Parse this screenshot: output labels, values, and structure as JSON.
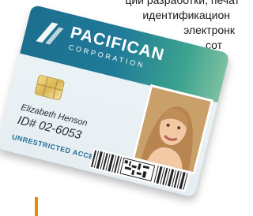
{
  "background": {
    "text_lines": [
      "ции разработки, печат",
      "идентификацион",
      "электронк",
      "сот"
    ],
    "accent_color": "#f08a00"
  },
  "card": {
    "brand_name": "PACIFICAN",
    "brand_sub": "CORPORATION",
    "holder_name": "Elizabeth Henson",
    "id_number": "ID# 02-6053",
    "access_level": "UNRESTRICTED ACCESS",
    "colors": {
      "band_start": "#1d6e8f",
      "band_end": "#7cc0a1",
      "access_text": "#1f6f93"
    }
  }
}
